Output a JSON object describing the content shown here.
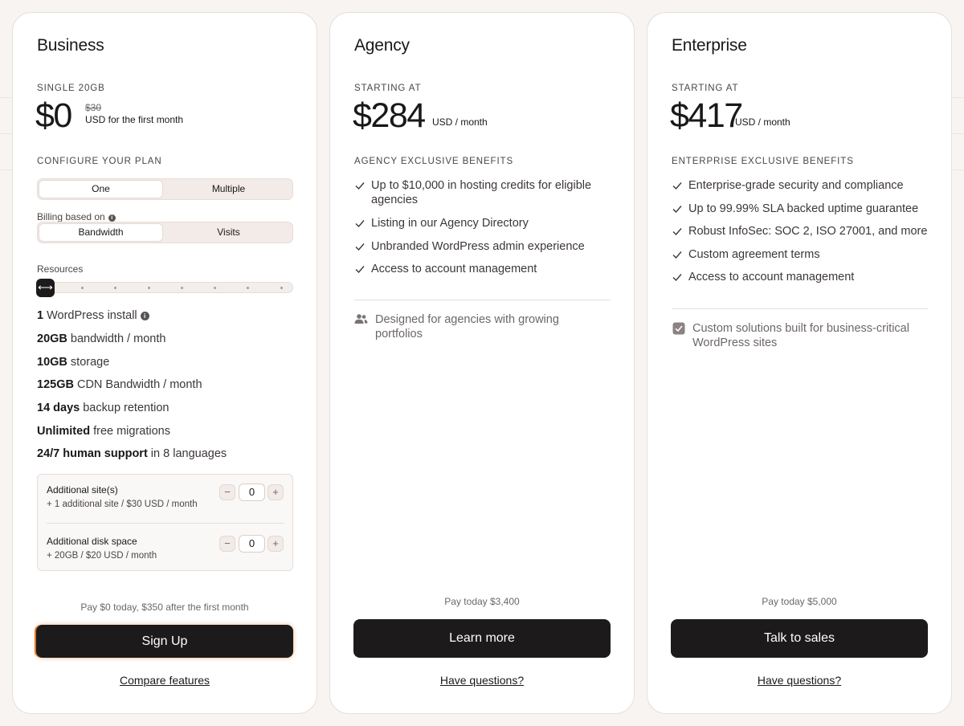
{
  "business": {
    "name": "Business",
    "eyebrow": "SINGLE 20GB",
    "price": "$0",
    "original_price": "$30",
    "price_note": "USD for the first month",
    "configure_label": "CONFIGURE YOUR PLAN",
    "plan_toggle": {
      "selected": "One",
      "other": "Multiple"
    },
    "billing_label": "Billing based on",
    "billing_toggle": {
      "selected": "Bandwidth",
      "other": "Visits"
    },
    "resources_label": "Resources",
    "resources_level": 0,
    "features": [
      {
        "bold": "1",
        "rest": " WordPress install"
      },
      {
        "bold": "20GB",
        "rest": " bandwidth / month"
      },
      {
        "bold": "10GB",
        "rest": " storage"
      },
      {
        "bold": "125GB",
        "rest": " CDN Bandwidth / month"
      },
      {
        "bold": "14 days",
        "rest": " backup retention"
      },
      {
        "bold": "Unlimited",
        "rest": " free migrations"
      },
      {
        "bold": "24/7 human support",
        "rest": " in 8 languages"
      }
    ],
    "addons": [
      {
        "title": "Additional site(s)",
        "subtitle": "+ 1 additional site / $30 USD / month",
        "value": "0"
      },
      {
        "title": "Additional disk space",
        "subtitle": "+ 20GB / $20 USD / month",
        "value": "0"
      }
    ],
    "pay_note": "Pay $0 today, $350 after the first month",
    "cta": "Sign Up",
    "link": "Compare features"
  },
  "agency": {
    "name": "Agency",
    "eyebrow": "STARTING AT",
    "price": "$284",
    "per": "USD / month",
    "benefits_label": "AGENCY EXCLUSIVE BENEFITS",
    "benefits": [
      "Up to $10,000 in hosting credits for eligible agencies",
      "Listing in our Agency Directory",
      "Unbranded WordPress admin experience",
      "Access to account management"
    ],
    "note": "Designed for agencies with growing portfolios",
    "pay_note": "Pay today $3,400",
    "cta": "Learn more",
    "link": "Have questions?"
  },
  "enterprise": {
    "name": "Enterprise",
    "eyebrow": "STARTING AT",
    "price": "$417",
    "per": "USD / month",
    "benefits_label": "ENTERPRISE EXCLUSIVE BENEFITS",
    "benefits": [
      "Enterprise-grade security and compliance",
      "Up to 99.99% SLA backed uptime guarantee",
      "Robust InfoSec: SOC 2, ISO 27001, and more",
      "Custom agreement terms",
      "Access to account management"
    ],
    "note": "Custom solutions built for business-critical WordPress sites",
    "pay_note": "Pay today $5,000",
    "cta": "Talk to sales",
    "link": "Have questions?"
  },
  "colors": {
    "accent_glow": "#e0782a",
    "dark": "#1c1a1a",
    "card_bg": "#ffffff",
    "page_bg": "#f7f4f1"
  }
}
